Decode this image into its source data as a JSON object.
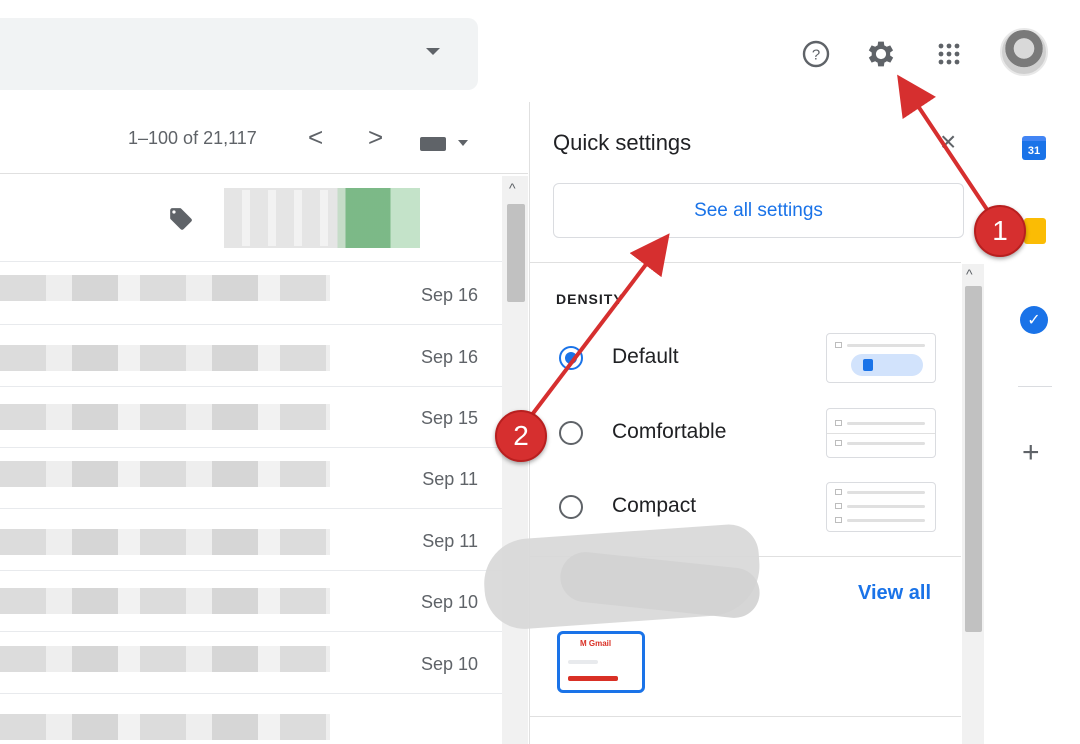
{
  "header": {
    "help_tooltip": "?",
    "icons": [
      "search-dropdown-caret",
      "help-icon",
      "gear-icon",
      "apps-grid-icon",
      "avatar"
    ]
  },
  "toolbar": {
    "pager_text": "1–100 of 21,117",
    "prev_glyph": "<",
    "next_glyph": ">"
  },
  "mail_list": {
    "rows": [
      {
        "date": "Sep 16"
      },
      {
        "date": "Sep 16"
      },
      {
        "date": "Sep 15"
      },
      {
        "date": "Sep 11"
      },
      {
        "date": "Sep 11"
      },
      {
        "date": "Sep 10"
      },
      {
        "date": "Sep 10"
      }
    ]
  },
  "quick_settings": {
    "title": "Quick settings",
    "close_glyph": "×",
    "see_all_label": "See all settings",
    "density_heading": "DENSITY",
    "density_options": [
      {
        "label": "Default",
        "checked": true
      },
      {
        "label": "Comfortable",
        "checked": false
      },
      {
        "label": "Compact",
        "checked": false
      }
    ],
    "view_all_label": "View all",
    "theme_gmail_label": "M Gmail"
  },
  "side_panel": {
    "calendar_number": "31",
    "add_glyph": "+"
  },
  "annotations": {
    "badge_1": "1",
    "badge_2": "2",
    "arrow_color": "#d62f2f"
  },
  "colors": {
    "accent": "#1a73e8",
    "annotation_red": "#d62f2f"
  }
}
